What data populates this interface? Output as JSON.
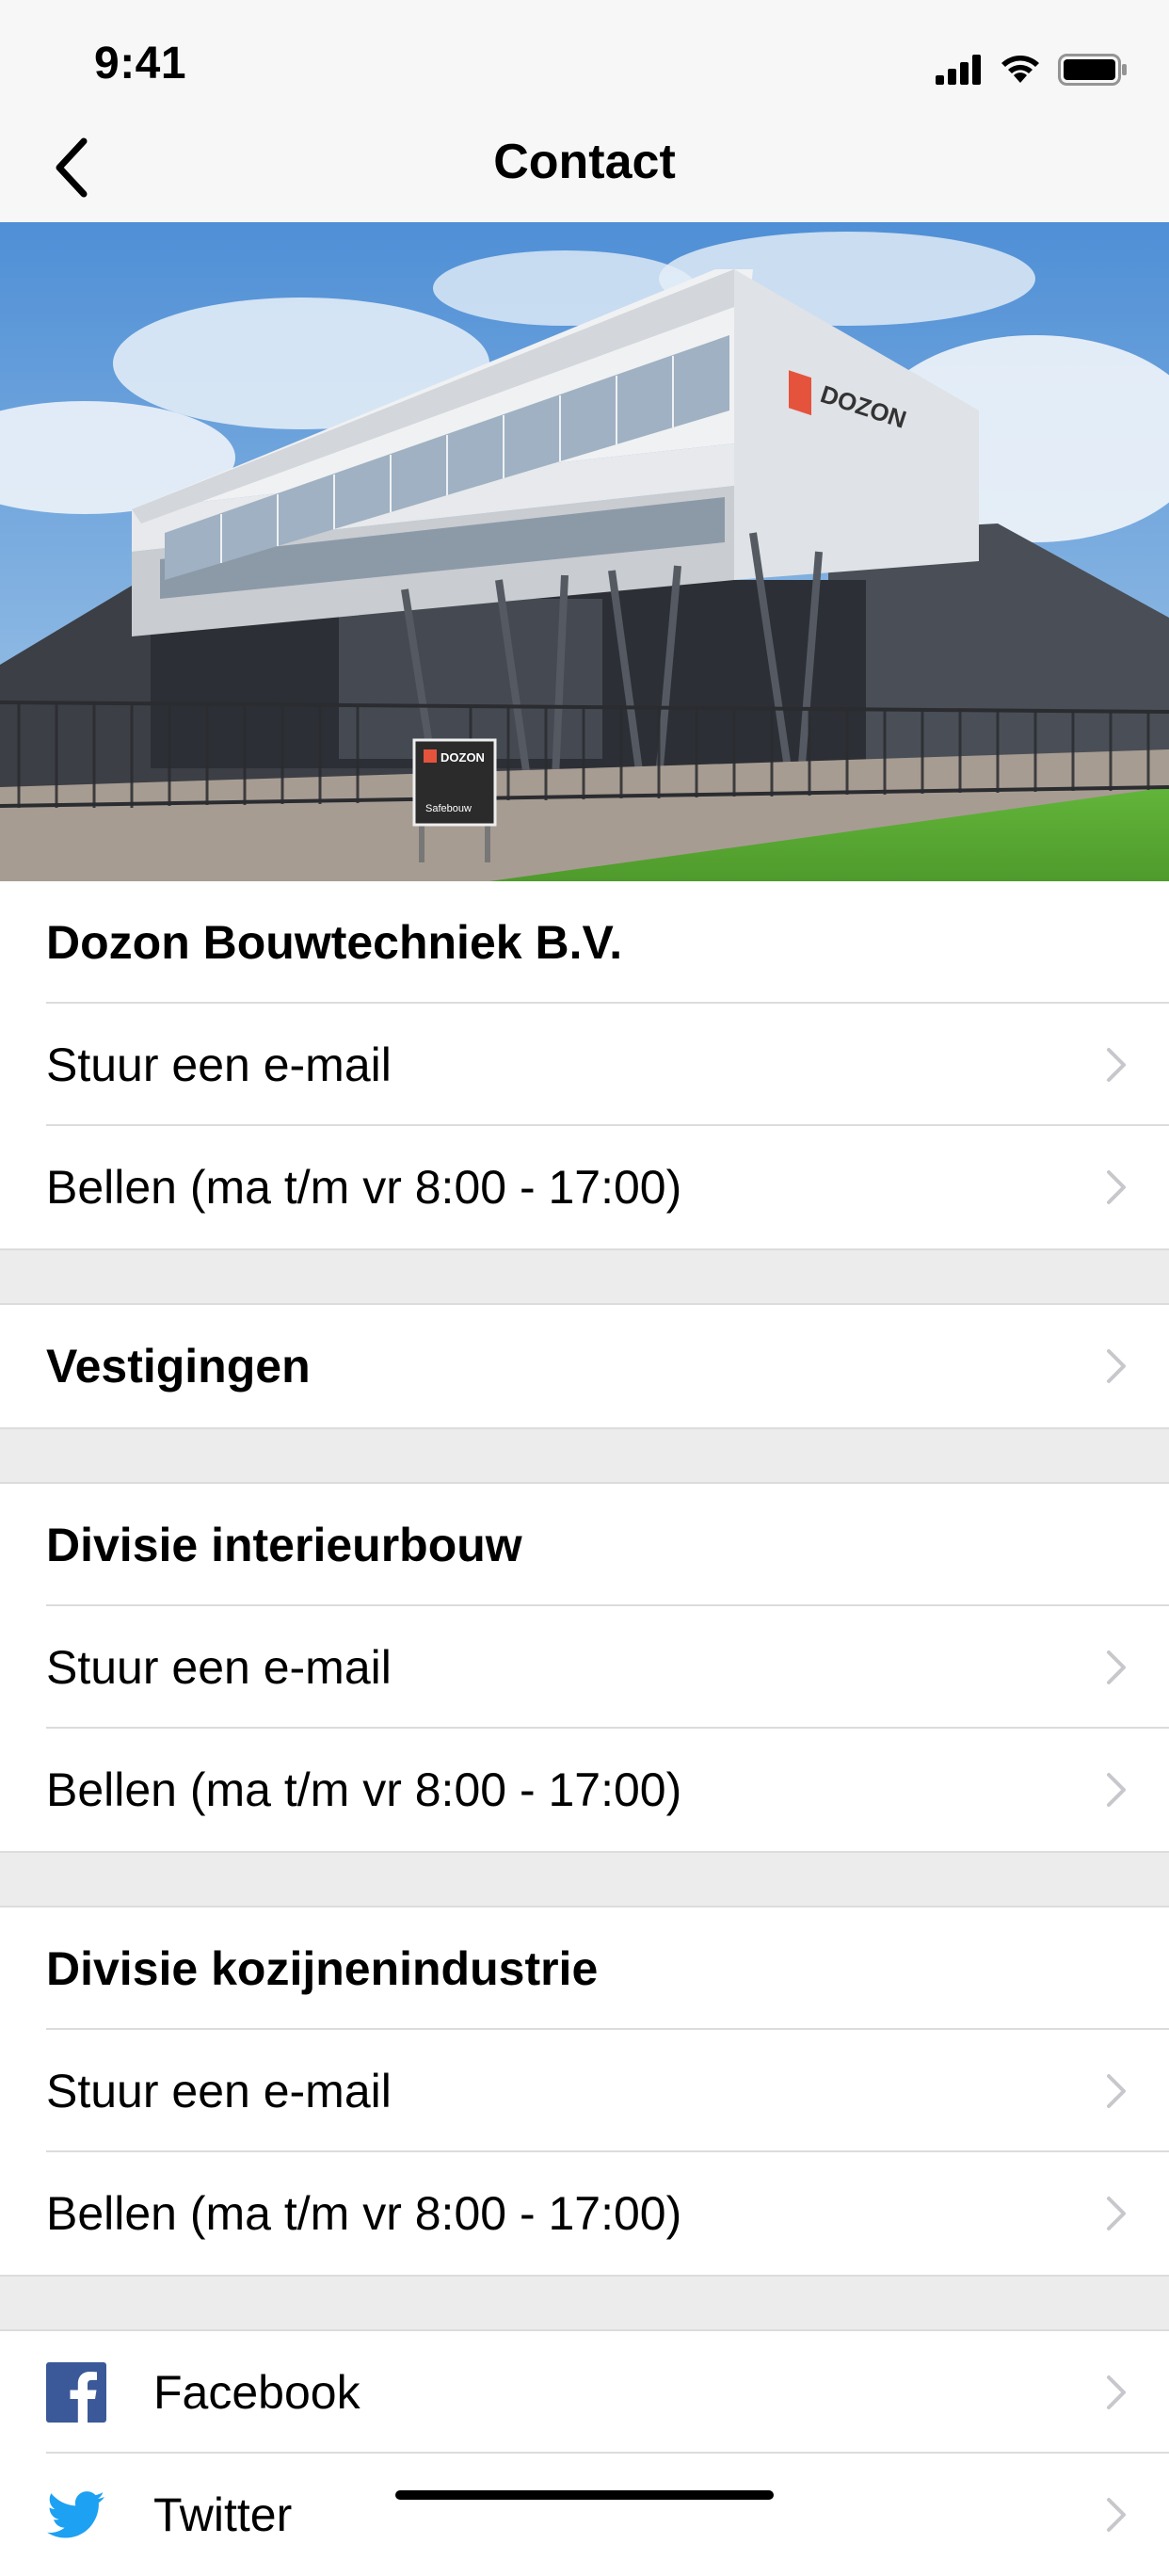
{
  "status_bar": {
    "time": "9:41"
  },
  "nav": {
    "title": "Contact"
  },
  "hero": {
    "alt": "Dozon Bouwtechniek building",
    "sign_brand": "DOZON",
    "sign_sub": "Safebouw"
  },
  "company": {
    "title": "Dozon Bouwtechniek B.V.",
    "email": "Stuur een e-mail",
    "call": "Bellen (ma t/m vr 8:00 - 17:00)"
  },
  "locations": {
    "title": "Vestigingen"
  },
  "interior": {
    "title": "Divisie interieurbouw",
    "email": "Stuur een e-mail",
    "call": "Bellen (ma t/m vr 8:00 - 17:00)"
  },
  "frames": {
    "title": "Divisie kozijnenindustrie",
    "email": "Stuur een e-mail",
    "call": "Bellen (ma t/m vr 8:00 - 17:00)"
  },
  "social": {
    "facebook": "Facebook",
    "twitter": "Twitter"
  },
  "colors": {
    "facebook": "#3b5998",
    "twitter": "#1da1f2",
    "chevron": "#c7c7cc",
    "brand": "#e5533c"
  }
}
